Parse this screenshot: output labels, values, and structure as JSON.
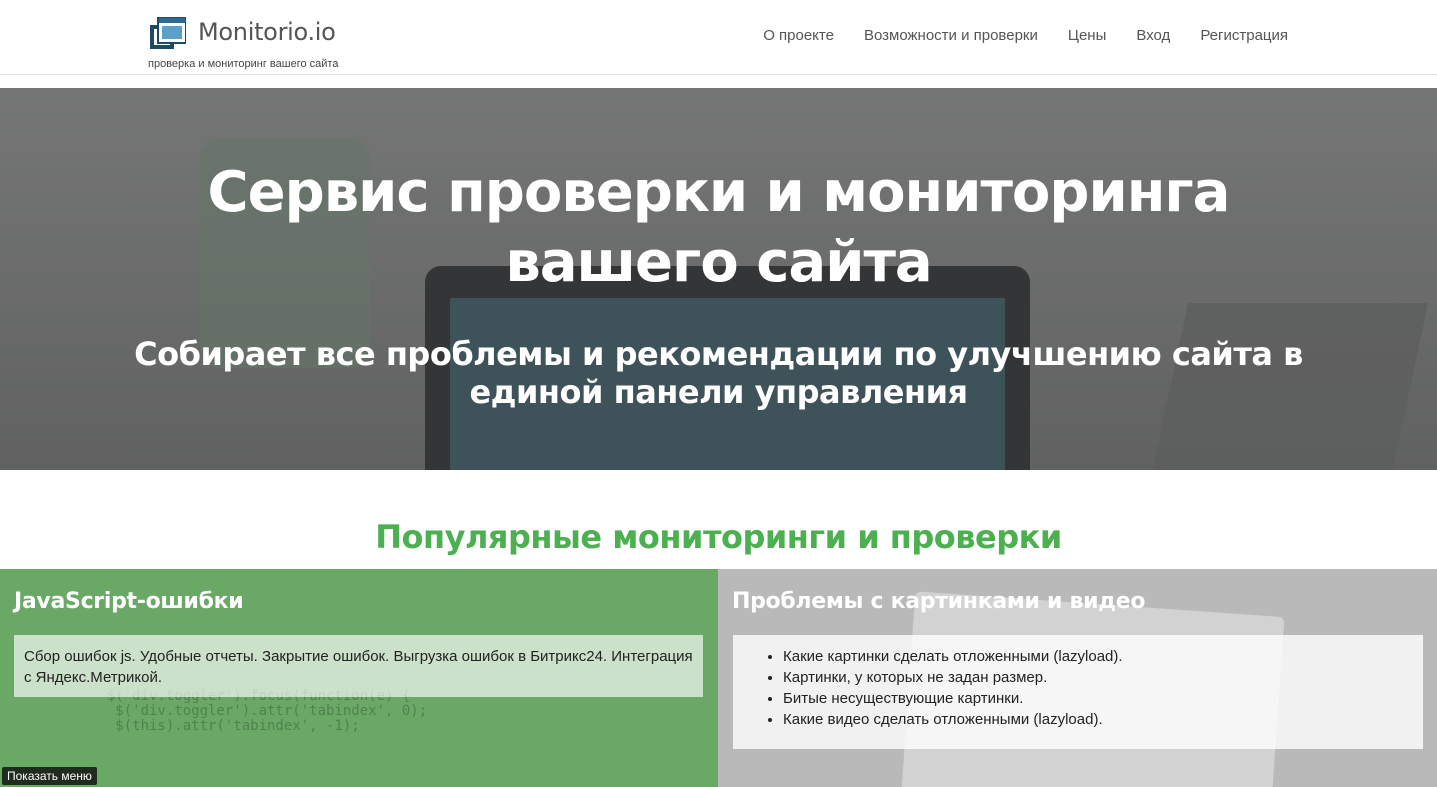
{
  "header": {
    "logo_text": "Monitorio.io",
    "tagline": "проверка и мониторинг вашего сайта",
    "logo_icon": "monitor-windows-icon",
    "nav": [
      {
        "label": "О проекте"
      },
      {
        "label": "Возможности и проверки"
      },
      {
        "label": "Цены"
      },
      {
        "label": "Вход"
      },
      {
        "label": "Регистрация"
      }
    ]
  },
  "hero": {
    "title": "Сервис проверки и мониторинга вашего сайта",
    "subtitle": "Собирает все проблемы и рекомендации по улучшению сайта в единой панели управления"
  },
  "popular": {
    "title": "Популярные мониторинги и проверки",
    "title_color": "#4caf50",
    "cards": [
      {
        "title": "JavaScript-ошибки",
        "text": "Сбор ошибок js. Удобные отчеты. Закрытие ошибок. Выгрузка ошибок в Битрикс24. Интеграция с Яндекс.Метрикой.",
        "color": "#6aa866"
      },
      {
        "title": "Проблемы с картинками и видео",
        "items": [
          "Какие картинки сделать отложенными (lazyload).",
          "Картинки, у которых не задан размер.",
          "Битые несуществующие картинки.",
          "Какие видео сделать отложенными (lazyload)."
        ],
        "color": "#b9b9b9"
      }
    ]
  },
  "menu_button": {
    "label": "Показать меню"
  }
}
